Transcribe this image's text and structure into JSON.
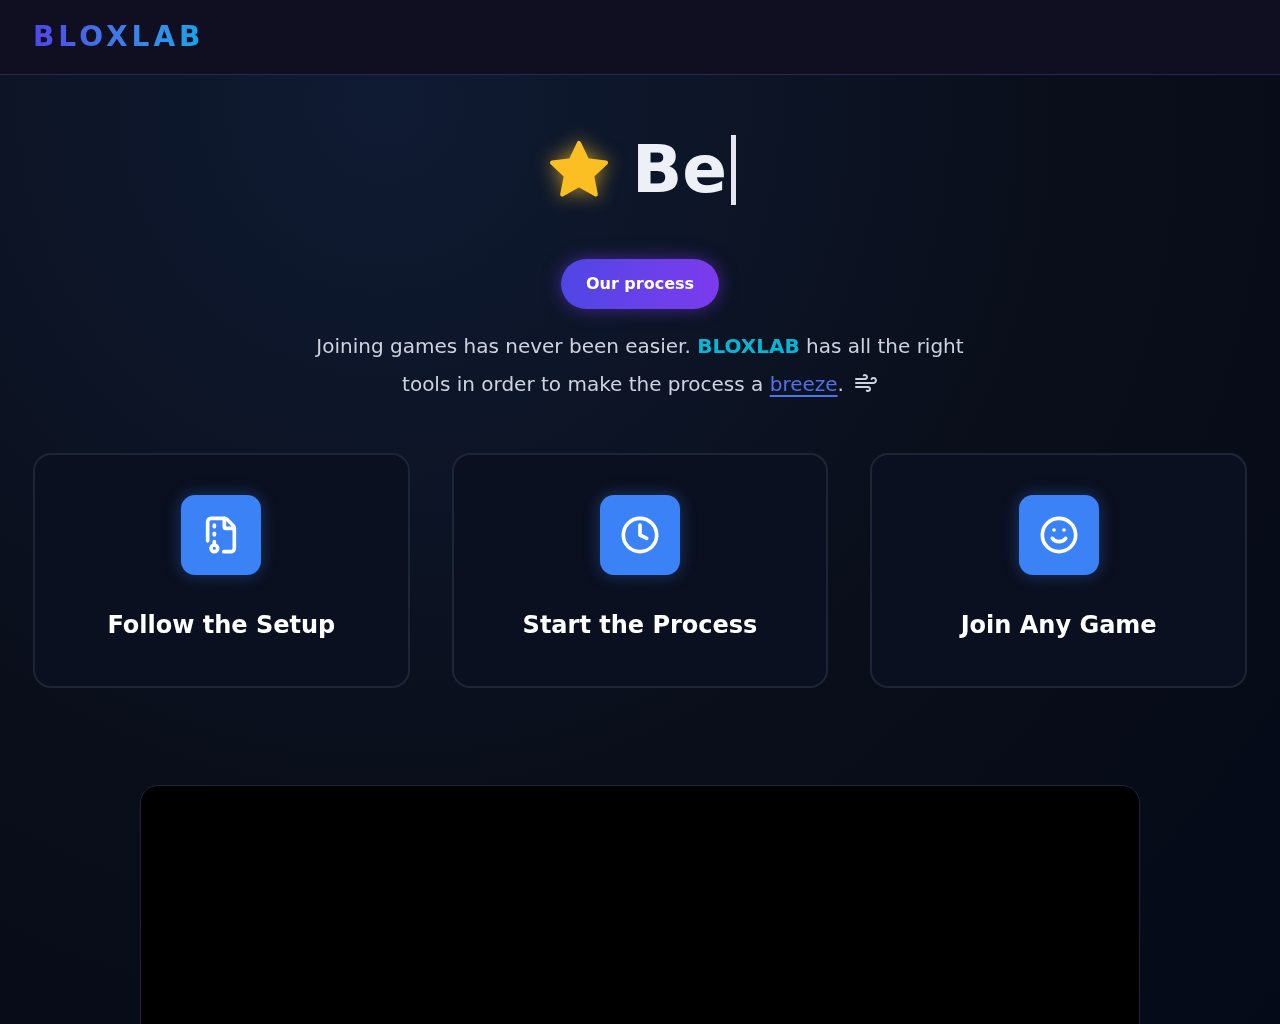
{
  "header": {
    "logo": "BLOXLAB"
  },
  "hero": {
    "title": "Be",
    "button": "Our process",
    "paragraph": [
      {
        "kind": "text",
        "text": "Joining games has never been easier. "
      },
      {
        "kind": "brand",
        "text": "BLOXLAB"
      },
      {
        "kind": "text",
        "text": " has all the right tools in order to make the process a "
      },
      {
        "kind": "link",
        "text": "breeze"
      },
      {
        "kind": "text",
        "text": "."
      }
    ]
  },
  "cards": [
    {
      "kind": "archive",
      "title": "Follow the Setup"
    },
    {
      "kind": "clock",
      "title": "Start the Process"
    },
    {
      "kind": "smile",
      "title": "Join Any Game"
    }
  ]
}
